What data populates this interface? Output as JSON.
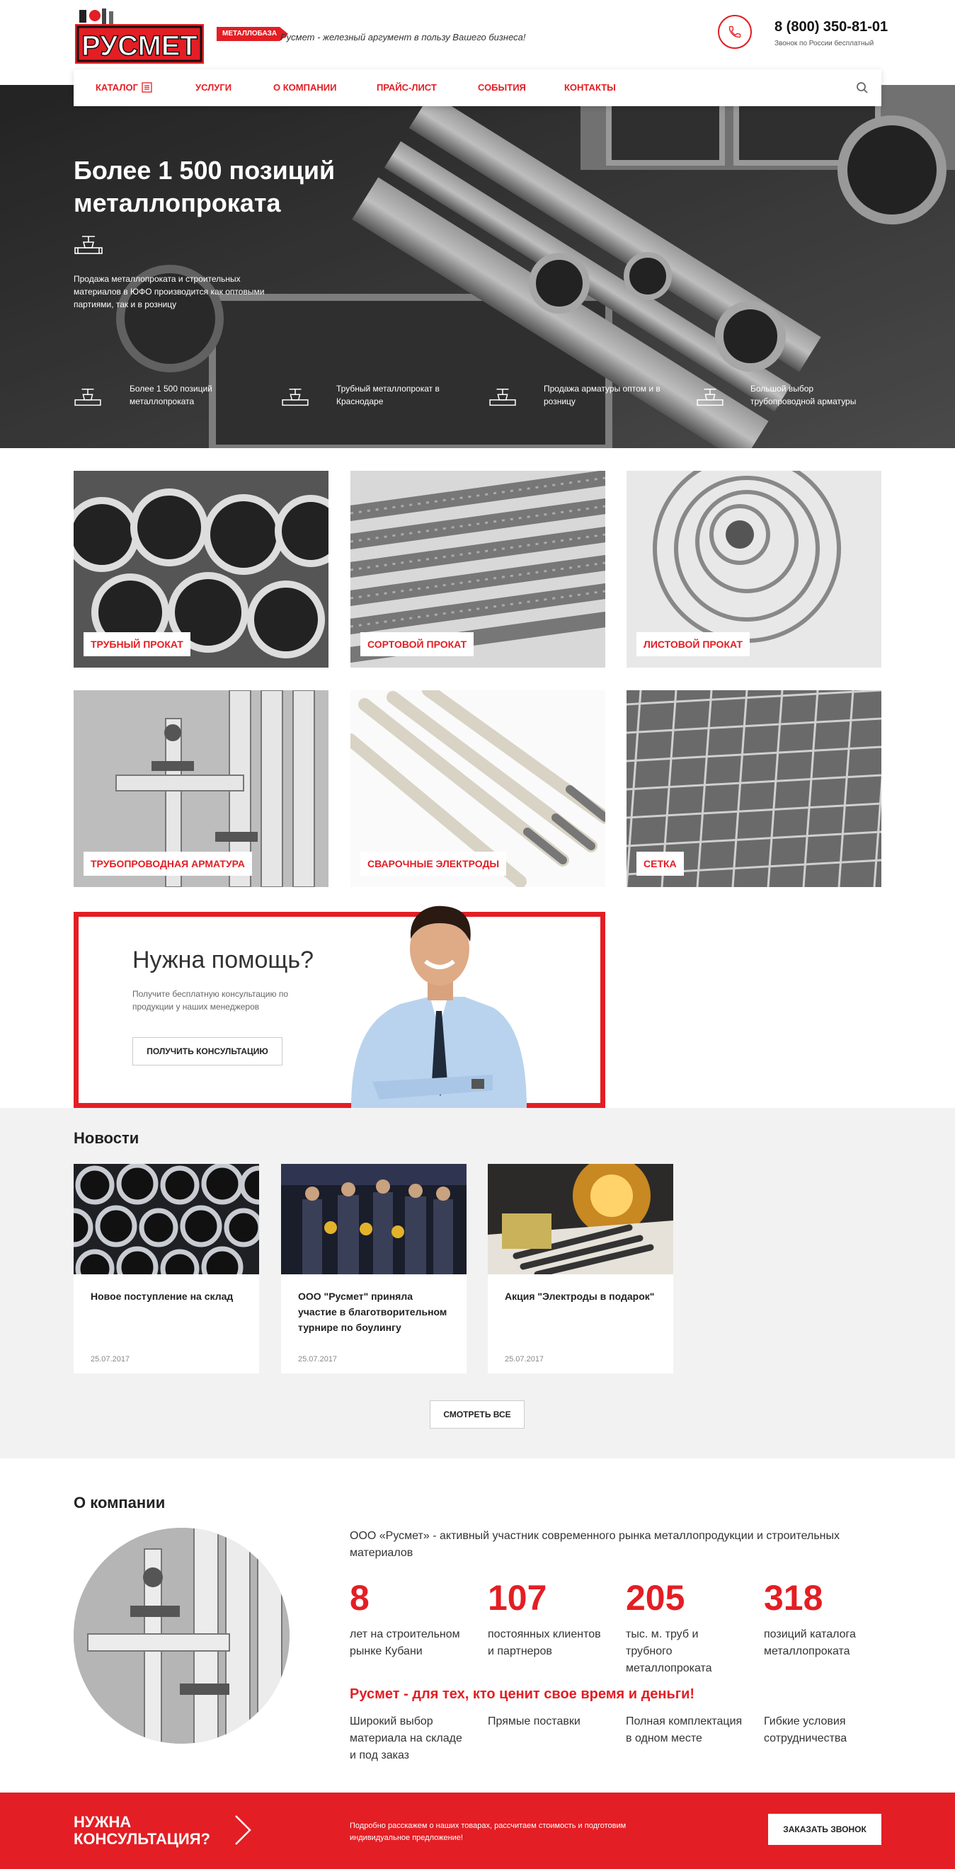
{
  "header": {
    "logo_text": "РУСМЕТ",
    "badge": "МЕТАЛЛОБАЗА",
    "tagline": "Русмет - железный аргумент в пользу Вашего бизнеса!",
    "phone": "8 (800) 350-81-01",
    "phone_note": "Звонок по России бесплатный"
  },
  "nav": {
    "items": [
      {
        "label": "КАТАЛОГ"
      },
      {
        "label": "УСЛУГИ"
      },
      {
        "label": "О КОМПАНИИ"
      },
      {
        "label": "ПРАЙС-ЛИСТ"
      },
      {
        "label": "СОБЫТИЯ"
      },
      {
        "label": "КОНТАКТЫ"
      }
    ]
  },
  "hero": {
    "title": "Более 1 500 позиций металлопроката",
    "description": "Продажа металлопроката и строительных материалов в ЮФО производится как оптовыми партиями, так и в розницу",
    "features": [
      {
        "text": "Более 1 500 позиций металлопроката"
      },
      {
        "text": "Трубный металлопрокат в Краснодаре"
      },
      {
        "text": "Продажа арматуры оптом и в розницу"
      },
      {
        "text": "Большой выбор трубопроводной арматуры"
      }
    ]
  },
  "catalog": [
    {
      "label": "ТРУБНЫЙ ПРОКАТ"
    },
    {
      "label": "СОРТОВОЙ ПРОКАТ"
    },
    {
      "label": "ЛИСТОВОЙ ПРОКАТ"
    },
    {
      "label": "ТРУБОПРОВОДНАЯ АРМАТУРА"
    },
    {
      "label": "СВАРОЧНЫЕ ЭЛЕКТРОДЫ"
    },
    {
      "label": "СЕТКА"
    }
  ],
  "help": {
    "title": "Нужна помощь?",
    "text": "Получите бесплатную консультацию по продукции у наших менеджеров",
    "button": "ПОЛУЧИТЬ КОНСУЛЬТАЦИЮ"
  },
  "news": {
    "title": "Новости",
    "items": [
      {
        "title": "Новое поступление на склад",
        "date": "25.07.2017"
      },
      {
        "title": "ООО \"Русмет\" приняла участие в благотворительном турнире по боулингу",
        "date": "25.07.2017"
      },
      {
        "title": "Акция \"Электроды в подарок\"",
        "date": "25.07.2017"
      }
    ],
    "all_button": "СМОТРЕТЬ ВСЕ"
  },
  "about": {
    "title": "О компании",
    "lead": "ООО «Русмет» - активный участник современного рынка металлопродукции и строительных материалов",
    "stats": [
      {
        "num": "8",
        "text": "лет на строительном рынке Кубани"
      },
      {
        "num": "107",
        "text": "постоянных клиентов и партнеров"
      },
      {
        "num": "205",
        "text": "тыс. м. труб и трубного металлопроката"
      },
      {
        "num": "318",
        "text": "позиций каталога металлопроката"
      }
    ],
    "slogan": "Русмет - для тех, кто ценит свое время и деньги!",
    "advantages": [
      {
        "text": "Широкий выбор материала на складе и под заказ"
      },
      {
        "text": "Прямые поставки"
      },
      {
        "text": "Полная комплектация в одном месте"
      },
      {
        "text": "Гибкие условия сотрудничества"
      }
    ]
  },
  "footer": {
    "title": "НУЖНА КОНСУЛЬТАЦИЯ?",
    "text": "Подробно расскажем о наших товарах, рассчитаем стоимость и подготовим индивидуальное предложение!",
    "button": "ЗАКАЗАТЬ ЗВОНОК"
  },
  "colors": {
    "accent": "#e31e24",
    "news_bg": "#f2f2f2"
  },
  "icons": [
    "phone-icon",
    "catalog-icon",
    "search-icon",
    "valve-icon",
    "arrow-right-icon"
  ]
}
